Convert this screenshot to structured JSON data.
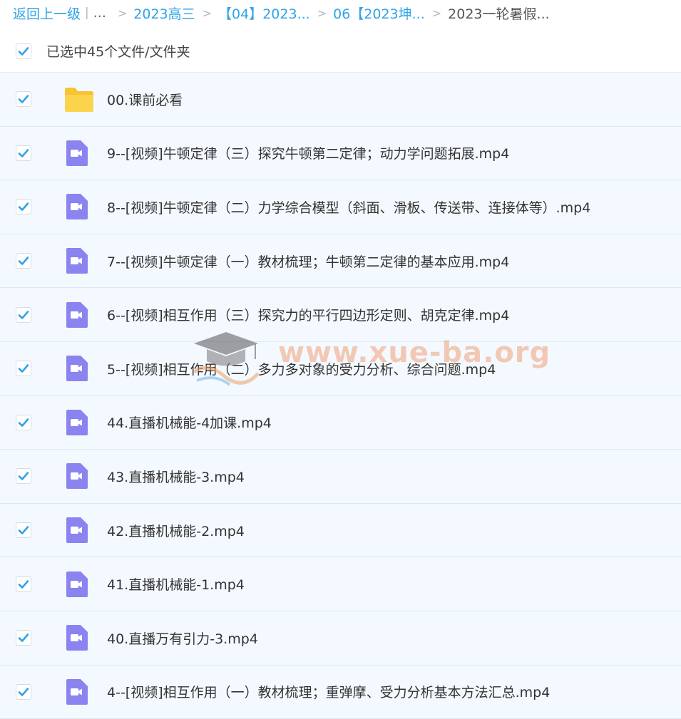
{
  "breadcrumb": {
    "back_label": "返回上一级",
    "ellipsis": "...",
    "items": [
      "2023高三",
      "【04】2023...",
      "06【2023坤...",
      "2023一轮暑假..."
    ]
  },
  "selection": {
    "label": "已选中45个文件/文件夹",
    "checked": true
  },
  "colors": {
    "accent": "#2fa3e6",
    "checkbox_check": "#2fa3e6",
    "row_bg": "#f4f9ff",
    "video_icon": "#8a83f0",
    "folder_icon": "#fcd34d"
  },
  "files": [
    {
      "name": "00.课前必看",
      "type": "folder",
      "icon": "folder-icon",
      "checked": true
    },
    {
      "name": "9--[视频]牛顿定律（三）探究牛顿第二定律；动力学问题拓展.mp4",
      "type": "video",
      "icon": "video-icon",
      "checked": true
    },
    {
      "name": "8--[视频]牛顿定律（二）力学综合模型（斜面、滑板、传送带、连接体等）.mp4",
      "type": "video",
      "icon": "video-icon",
      "checked": true
    },
    {
      "name": "7--[视频]牛顿定律（一）教材梳理；牛顿第二定律的基本应用.mp4",
      "type": "video",
      "icon": "video-icon",
      "checked": true
    },
    {
      "name": "6--[视频]相互作用（三）探究力的平行四边形定则、胡克定律.mp4",
      "type": "video",
      "icon": "video-icon",
      "checked": true
    },
    {
      "name": "5--[视频]相互作用（二）多力多对象的受力分析、综合问题.mp4",
      "type": "video",
      "icon": "video-icon",
      "checked": true
    },
    {
      "name": "44.直播机械能-4加课.mp4",
      "type": "video",
      "icon": "video-icon",
      "checked": true
    },
    {
      "name": "43.直播机械能-3.mp4",
      "type": "video",
      "icon": "video-icon",
      "checked": true
    },
    {
      "name": "42.直播机械能-2.mp4",
      "type": "video",
      "icon": "video-icon",
      "checked": true
    },
    {
      "name": "41.直播机械能-1.mp4",
      "type": "video",
      "icon": "video-icon",
      "checked": true
    },
    {
      "name": "40.直播万有引力-3.mp4",
      "type": "video",
      "icon": "video-icon",
      "checked": true
    },
    {
      "name": "4--[视频]相互作用（一）教材梳理；重弹摩、受力分析基本方法汇总.mp4",
      "type": "video",
      "icon": "video-icon",
      "checked": true
    }
  ],
  "watermark": {
    "text": "www.xue-ba.org",
    "icon": "graduation-cap-logo"
  }
}
